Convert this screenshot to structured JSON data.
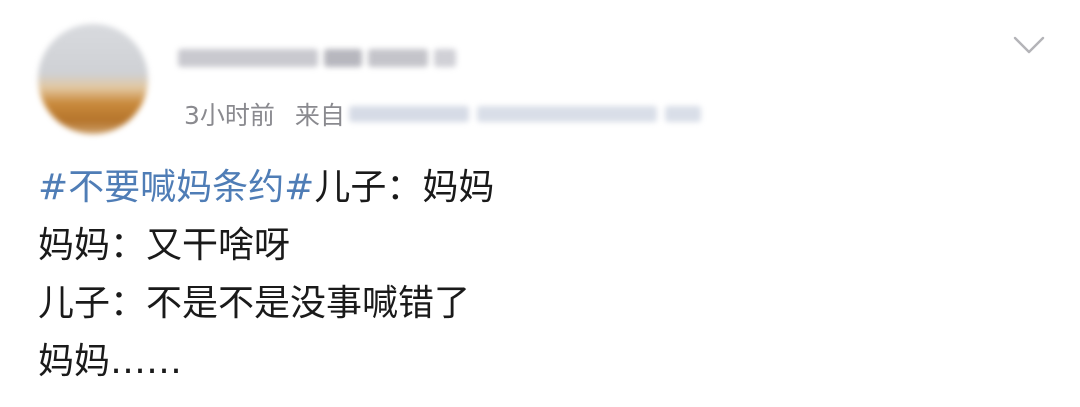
{
  "user": {
    "avatar_icon": "blurred-avatar",
    "name_text": ""
  },
  "meta": {
    "time": "3小时前",
    "from_label": "来自"
  },
  "post": {
    "hashtag": "#不要喊妈条约#",
    "lines": [
      "儿子：妈妈",
      "妈妈：又干啥呀",
      "儿子：不是不是没事喊错了",
      "妈妈……"
    ]
  },
  "colors": {
    "hashtag": "#4f7db6",
    "text": "#1a1a1a",
    "meta": "#8a8a8f"
  },
  "icons": {
    "menu": "chevron-down-icon"
  }
}
